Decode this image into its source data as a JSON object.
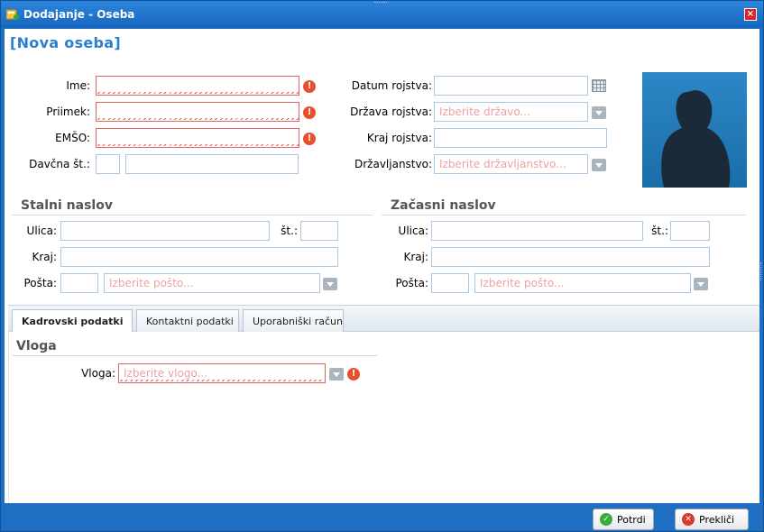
{
  "window": {
    "title": "Dodajanje - Oseba",
    "close_label": "×"
  },
  "form": {
    "heading": "[Nova oseba]",
    "ime_label": "Ime:",
    "priimek_label": "Priimek:",
    "emso_label": "EMŠO:",
    "davcna_label": "Davčna št.:",
    "datum_label": "Datum rojstva:",
    "drzava_label": "Država rojstva:",
    "drzava_placeholder": "Izberite državo...",
    "kraj_rojstva_label": "Kraj rojstva:",
    "drzavljanstvo_label": "Državljanstvo:",
    "drzavljanstvo_placeholder": "Izberite državljanstvo...",
    "warning_glyph": "!"
  },
  "stalni": {
    "title": "Stalni naslov",
    "ulica_label": "Ulica:",
    "st_label": "št.:",
    "kraj_label": "Kraj:",
    "posta_label": "Pošta:",
    "posta_placeholder": "Izberite pošto..."
  },
  "zacasni": {
    "title": "Začasni naslov",
    "ulica_label": "Ulica:",
    "st_label": "št.:",
    "kraj_label": "Kraj:",
    "posta_label": "Pošta:",
    "posta_placeholder": "Izberite pošto..."
  },
  "tabs": [
    {
      "label": "Kadrovski podatki",
      "active": true
    },
    {
      "label": "Kontaktni podatki",
      "active": false
    },
    {
      "label": "Uporabniški račun",
      "active": false
    }
  ],
  "kadrovski": {
    "section_title": "Vloga",
    "vloga_label": "Vloga:",
    "vloga_placeholder": "Izberite vlogo..."
  },
  "footer": {
    "confirm_label": "Potrdi",
    "cancel_label": "Prekliči"
  },
  "colors": {
    "accent": "#1e6fc2",
    "heading": "#2a7fcf",
    "error": "#e8502c"
  }
}
